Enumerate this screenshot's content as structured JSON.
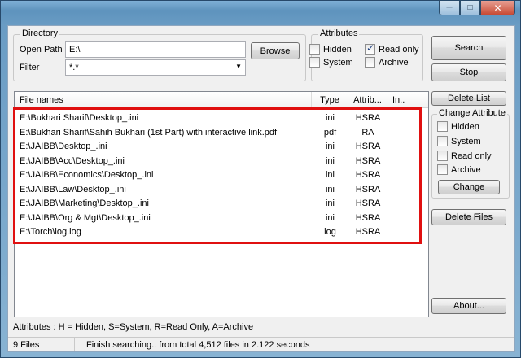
{
  "window": {
    "controls": [
      "─",
      "□",
      "✕"
    ]
  },
  "directory": {
    "group_title": "Directory",
    "open_path_label": "Open Path",
    "open_path_value": "E:\\",
    "browse_label": "Browse",
    "filter_label": "Filter",
    "filter_value": "*.*"
  },
  "attributes": {
    "group_title": "Attributes",
    "hidden": {
      "label": "Hidden",
      "checked": false
    },
    "read_only": {
      "label": "Read only",
      "checked": true
    },
    "system": {
      "label": "System",
      "checked": false
    },
    "archive": {
      "label": "Archive",
      "checked": false
    }
  },
  "buttons": {
    "search": "Search",
    "stop": "Stop",
    "delete_list": "Delete List",
    "change": "Change",
    "delete_files": "Delete Files",
    "about": "About..."
  },
  "change_attribute": {
    "title": "Change Attribute",
    "hidden": "Hidden",
    "system": "System",
    "read_only": "Read only",
    "archive": "Archive"
  },
  "list": {
    "columns": [
      "File names",
      "Type",
      "Attrib...",
      "In..."
    ],
    "rows": [
      {
        "name": "E:\\Bukhari Sharif\\Desktop_.ini",
        "type": "ini",
        "attrib": "HSRA"
      },
      {
        "name": "E:\\Bukhari Sharif\\Sahih Bukhari (1st Part) with interactive link.pdf",
        "type": "pdf",
        "attrib": "RA"
      },
      {
        "name": "E:\\JAIBB\\Desktop_.ini",
        "type": "ini",
        "attrib": "HSRA"
      },
      {
        "name": "E:\\JAIBB\\Acc\\Desktop_.ini",
        "type": "ini",
        "attrib": "HSRA"
      },
      {
        "name": "E:\\JAIBB\\Economics\\Desktop_.ini",
        "type": "ini",
        "attrib": "HSRA"
      },
      {
        "name": "E:\\JAIBB\\Law\\Desktop_.ini",
        "type": "ini",
        "attrib": "HSRA"
      },
      {
        "name": "E:\\JAIBB\\Marketing\\Desktop_.ini",
        "type": "ini",
        "attrib": "HSRA"
      },
      {
        "name": "E:\\JAIBB\\Org & Mgt\\Desktop_.ini",
        "type": "ini",
        "attrib": "HSRA"
      },
      {
        "name": "E:\\Torch\\log.log",
        "type": "log",
        "attrib": "HSRA"
      }
    ]
  },
  "legend": "Attributes : H = Hidden, S=System, R=Read Only, A=Archive",
  "status": {
    "file_count": "9 Files",
    "message": "Finish searching.. from total 4,512 files in 2.122 seconds"
  },
  "colors": {
    "highlight": "#e01010"
  }
}
